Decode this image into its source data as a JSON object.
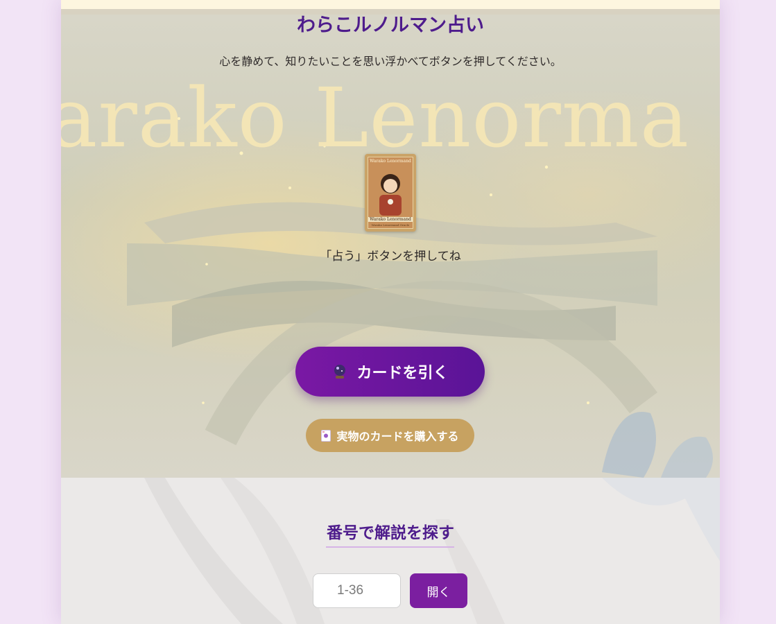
{
  "header": {
    "title": "わらこルノルマン占い",
    "subtitle": "心を静めて、知りたいことを思い浮かべてボタンを押してください。"
  },
  "hero": {
    "wordmark": "arako Lenorma"
  },
  "card": {
    "top_text": "Warako Lenormand",
    "bottom_text": "Warako Lenormand",
    "caption_text": "Warako Lenormand Oracle"
  },
  "reading": {
    "prompt": "「占う」ボタンを押してね"
  },
  "buttons": {
    "draw_label": "カードを引く",
    "draw_icon": "crystal-ball-icon",
    "buy_label": "実物のカードを購入する",
    "buy_icon": "card-icon"
  },
  "search": {
    "title": "番号で解説を探す",
    "input_placeholder": "1-36",
    "open_label": "開く"
  },
  "colors": {
    "accent_purple": "#5a1497",
    "gold": "#c7a261",
    "page_bg": "#f2e4f6"
  }
}
